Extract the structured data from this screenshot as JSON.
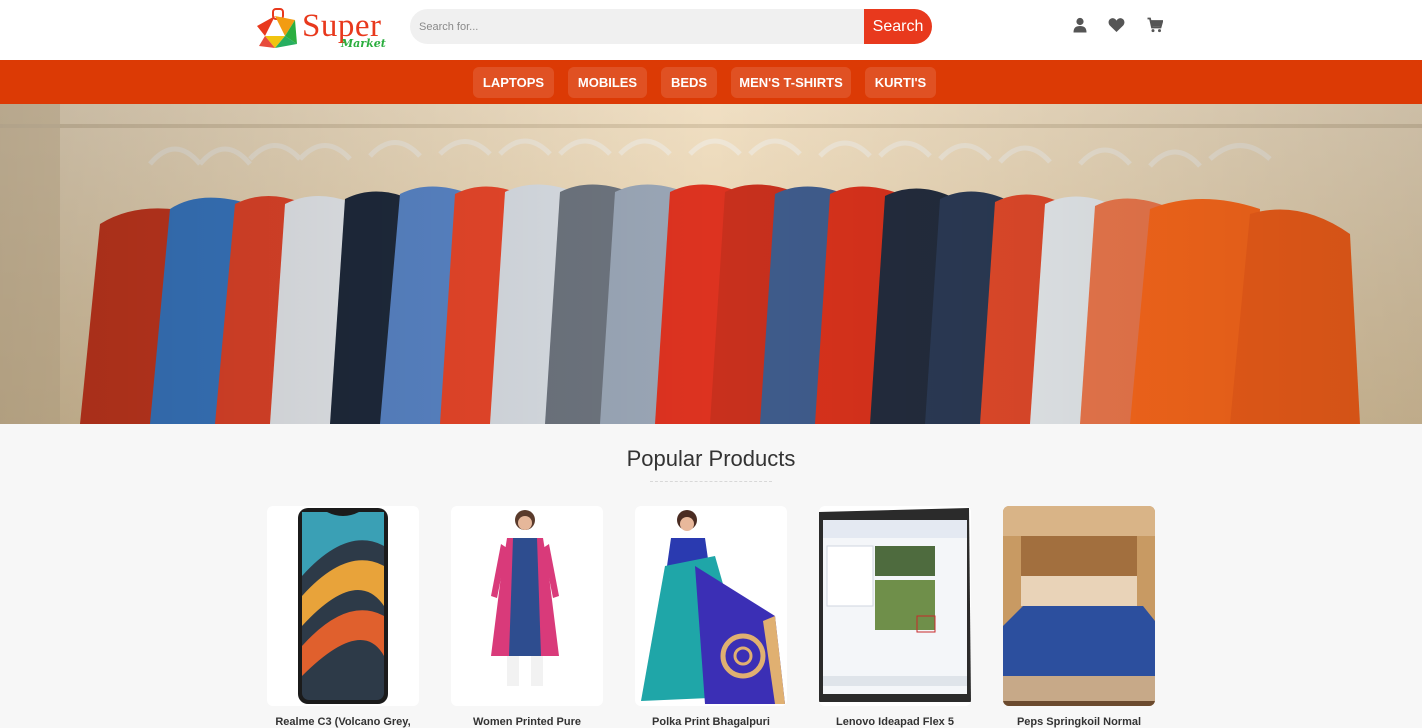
{
  "header": {
    "logo_text": "Super",
    "logo_sub": "Market",
    "search_placeholder": "Search for...",
    "search_button": "Search",
    "icons": [
      "user-icon",
      "heart-icon",
      "cart-icon"
    ]
  },
  "nav": {
    "items": [
      "LAPTOPS",
      "MOBILES",
      "BEDS",
      "MEN'S T-SHIRTS",
      "KURTI'S"
    ]
  },
  "colors": {
    "brand": "#e8391d",
    "nav_bg": "#dc3a05",
    "logo_green": "#2bae3f"
  },
  "popular": {
    "title": "Popular Products",
    "products": [
      {
        "name": "Realme C3 (Volcano Grey,",
        "image": "phone"
      },
      {
        "name": "Women Printed Pure",
        "image": "kurti"
      },
      {
        "name": "Polka Print Bhagalpuri",
        "image": "saree"
      },
      {
        "name": "Lenovo Ideapad Flex 5",
        "image": "laptop"
      },
      {
        "name": "Peps Springkoil Normal",
        "image": "bed"
      }
    ]
  }
}
